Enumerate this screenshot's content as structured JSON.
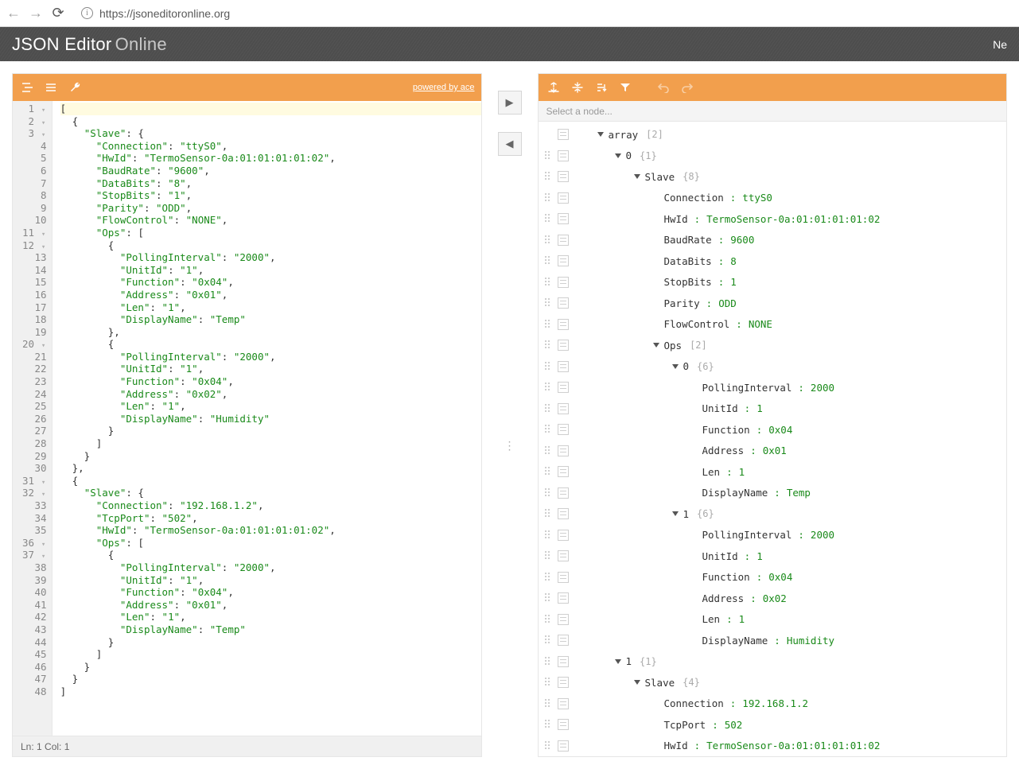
{
  "browser": {
    "url": "https://jsoneditoronline.org"
  },
  "header": {
    "title_strong": "JSON Editor",
    "title_light": "Online",
    "menu_right": "Ne"
  },
  "left": {
    "powered": "powered by ace",
    "status": "Ln: 1   Col: 1",
    "lines": [
      {
        "n": "1",
        "f": true,
        "hl": true,
        "t": "["
      },
      {
        "n": "2",
        "f": true,
        "t": "  {"
      },
      {
        "n": "3",
        "f": true,
        "t": "    \"Slave\": {",
        "seg": [
          [
            "k",
            "    "
          ],
          [
            "s",
            "\"Slave\""
          ],
          [
            "k",
            ": {"
          ]
        ]
      },
      {
        "n": "4",
        "t": "      \"Connection\": \"ttyS0\",",
        "seg": [
          [
            "k",
            "      "
          ],
          [
            "s",
            "\"Connection\""
          ],
          [
            "k",
            ": "
          ],
          [
            "s",
            "\"ttyS0\""
          ],
          [
            "k",
            ","
          ]
        ]
      },
      {
        "n": "5",
        "t": "",
        "seg": [
          [
            "k",
            "      "
          ],
          [
            "s",
            "\"HwId\""
          ],
          [
            "k",
            ": "
          ],
          [
            "s",
            "\"TermoSensor-0a:01:01:01:01:02\""
          ],
          [
            "k",
            ","
          ]
        ]
      },
      {
        "n": "6",
        "t": "",
        "seg": [
          [
            "k",
            "      "
          ],
          [
            "s",
            "\"BaudRate\""
          ],
          [
            "k",
            ": "
          ],
          [
            "s",
            "\"9600\""
          ],
          [
            "k",
            ","
          ]
        ]
      },
      {
        "n": "7",
        "t": "",
        "seg": [
          [
            "k",
            "      "
          ],
          [
            "s",
            "\"DataBits\""
          ],
          [
            "k",
            ": "
          ],
          [
            "s",
            "\"8\""
          ],
          [
            "k",
            ","
          ]
        ]
      },
      {
        "n": "8",
        "t": "",
        "seg": [
          [
            "k",
            "      "
          ],
          [
            "s",
            "\"StopBits\""
          ],
          [
            "k",
            ": "
          ],
          [
            "s",
            "\"1\""
          ],
          [
            "k",
            ","
          ]
        ]
      },
      {
        "n": "9",
        "t": "",
        "seg": [
          [
            "k",
            "      "
          ],
          [
            "s",
            "\"Parity\""
          ],
          [
            "k",
            ": "
          ],
          [
            "s",
            "\"ODD\""
          ],
          [
            "k",
            ","
          ]
        ]
      },
      {
        "n": "10",
        "t": "",
        "seg": [
          [
            "k",
            "      "
          ],
          [
            "s",
            "\"FlowControl\""
          ],
          [
            "k",
            ": "
          ],
          [
            "s",
            "\"NONE\""
          ],
          [
            "k",
            ","
          ]
        ]
      },
      {
        "n": "11",
        "f": true,
        "t": "",
        "seg": [
          [
            "k",
            "      "
          ],
          [
            "s",
            "\"Ops\""
          ],
          [
            "k",
            ": ["
          ]
        ]
      },
      {
        "n": "12",
        "f": true,
        "t": "        {"
      },
      {
        "n": "13",
        "t": "",
        "seg": [
          [
            "k",
            "          "
          ],
          [
            "s",
            "\"PollingInterval\""
          ],
          [
            "k",
            ": "
          ],
          [
            "s",
            "\"2000\""
          ],
          [
            "k",
            ","
          ]
        ]
      },
      {
        "n": "14",
        "t": "",
        "seg": [
          [
            "k",
            "          "
          ],
          [
            "s",
            "\"UnitId\""
          ],
          [
            "k",
            ": "
          ],
          [
            "s",
            "\"1\""
          ],
          [
            "k",
            ","
          ]
        ]
      },
      {
        "n": "15",
        "t": "",
        "seg": [
          [
            "k",
            "          "
          ],
          [
            "s",
            "\"Function\""
          ],
          [
            "k",
            ": "
          ],
          [
            "s",
            "\"0x04\""
          ],
          [
            "k",
            ","
          ]
        ]
      },
      {
        "n": "16",
        "t": "",
        "seg": [
          [
            "k",
            "          "
          ],
          [
            "s",
            "\"Address\""
          ],
          [
            "k",
            ": "
          ],
          [
            "s",
            "\"0x01\""
          ],
          [
            "k",
            ","
          ]
        ]
      },
      {
        "n": "17",
        "t": "",
        "seg": [
          [
            "k",
            "          "
          ],
          [
            "s",
            "\"Len\""
          ],
          [
            "k",
            ": "
          ],
          [
            "s",
            "\"1\""
          ],
          [
            "k",
            ","
          ]
        ]
      },
      {
        "n": "18",
        "t": "",
        "seg": [
          [
            "k",
            "          "
          ],
          [
            "s",
            "\"DisplayName\""
          ],
          [
            "k",
            ": "
          ],
          [
            "s",
            "\"Temp\""
          ]
        ]
      },
      {
        "n": "19",
        "t": "        },"
      },
      {
        "n": "20",
        "f": true,
        "t": "        {"
      },
      {
        "n": "21",
        "t": "",
        "seg": [
          [
            "k",
            "          "
          ],
          [
            "s",
            "\"PollingInterval\""
          ],
          [
            "k",
            ": "
          ],
          [
            "s",
            "\"2000\""
          ],
          [
            "k",
            ","
          ]
        ]
      },
      {
        "n": "22",
        "t": "",
        "seg": [
          [
            "k",
            "          "
          ],
          [
            "s",
            "\"UnitId\""
          ],
          [
            "k",
            ": "
          ],
          [
            "s",
            "\"1\""
          ],
          [
            "k",
            ","
          ]
        ]
      },
      {
        "n": "23",
        "t": "",
        "seg": [
          [
            "k",
            "          "
          ],
          [
            "s",
            "\"Function\""
          ],
          [
            "k",
            ": "
          ],
          [
            "s",
            "\"0x04\""
          ],
          [
            "k",
            ","
          ]
        ]
      },
      {
        "n": "24",
        "t": "",
        "seg": [
          [
            "k",
            "          "
          ],
          [
            "s",
            "\"Address\""
          ],
          [
            "k",
            ": "
          ],
          [
            "s",
            "\"0x02\""
          ],
          [
            "k",
            ","
          ]
        ]
      },
      {
        "n": "25",
        "t": "",
        "seg": [
          [
            "k",
            "          "
          ],
          [
            "s",
            "\"Len\""
          ],
          [
            "k",
            ": "
          ],
          [
            "s",
            "\"1\""
          ],
          [
            "k",
            ","
          ]
        ]
      },
      {
        "n": "26",
        "t": "",
        "seg": [
          [
            "k",
            "          "
          ],
          [
            "s",
            "\"DisplayName\""
          ],
          [
            "k",
            ": "
          ],
          [
            "s",
            "\"Humidity\""
          ]
        ]
      },
      {
        "n": "27",
        "t": "        }"
      },
      {
        "n": "28",
        "t": "      ]"
      },
      {
        "n": "29",
        "t": "    }"
      },
      {
        "n": "30",
        "t": "  },"
      },
      {
        "n": "31",
        "f": true,
        "t": "  {"
      },
      {
        "n": "32",
        "f": true,
        "t": "",
        "seg": [
          [
            "k",
            "    "
          ],
          [
            "s",
            "\"Slave\""
          ],
          [
            "k",
            ": {"
          ]
        ]
      },
      {
        "n": "33",
        "t": "",
        "seg": [
          [
            "k",
            "      "
          ],
          [
            "s",
            "\"Connection\""
          ],
          [
            "k",
            ": "
          ],
          [
            "s",
            "\"192.168.1.2\""
          ],
          [
            "k",
            ","
          ]
        ]
      },
      {
        "n": "34",
        "t": "",
        "seg": [
          [
            "k",
            "      "
          ],
          [
            "s",
            "\"TcpPort\""
          ],
          [
            "k",
            ": "
          ],
          [
            "s",
            "\"502\""
          ],
          [
            "k",
            ","
          ]
        ]
      },
      {
        "n": "35",
        "t": "",
        "seg": [
          [
            "k",
            "      "
          ],
          [
            "s",
            "\"HwId\""
          ],
          [
            "k",
            ": "
          ],
          [
            "s",
            "\"TermoSensor-0a:01:01:01:01:02\""
          ],
          [
            "k",
            ","
          ]
        ]
      },
      {
        "n": "36",
        "f": true,
        "t": "",
        "seg": [
          [
            "k",
            "      "
          ],
          [
            "s",
            "\"Ops\""
          ],
          [
            "k",
            ": ["
          ]
        ]
      },
      {
        "n": "37",
        "f": true,
        "t": "        {"
      },
      {
        "n": "38",
        "t": "",
        "seg": [
          [
            "k",
            "          "
          ],
          [
            "s",
            "\"PollingInterval\""
          ],
          [
            "k",
            ": "
          ],
          [
            "s",
            "\"2000\""
          ],
          [
            "k",
            ","
          ]
        ]
      },
      {
        "n": "39",
        "t": "",
        "seg": [
          [
            "k",
            "          "
          ],
          [
            "s",
            "\"UnitId\""
          ],
          [
            "k",
            ": "
          ],
          [
            "s",
            "\"1\""
          ],
          [
            "k",
            ","
          ]
        ]
      },
      {
        "n": "40",
        "t": "",
        "seg": [
          [
            "k",
            "          "
          ],
          [
            "s",
            "\"Function\""
          ],
          [
            "k",
            ": "
          ],
          [
            "s",
            "\"0x04\""
          ],
          [
            "k",
            ","
          ]
        ]
      },
      {
        "n": "41",
        "t": "",
        "seg": [
          [
            "k",
            "          "
          ],
          [
            "s",
            "\"Address\""
          ],
          [
            "k",
            ": "
          ],
          [
            "s",
            "\"0x01\""
          ],
          [
            "k",
            ","
          ]
        ]
      },
      {
        "n": "42",
        "t": "",
        "seg": [
          [
            "k",
            "          "
          ],
          [
            "s",
            "\"Len\""
          ],
          [
            "k",
            ": "
          ],
          [
            "s",
            "\"1\""
          ],
          [
            "k",
            ","
          ]
        ]
      },
      {
        "n": "43",
        "t": "",
        "seg": [
          [
            "k",
            "          "
          ],
          [
            "s",
            "\"DisplayName\""
          ],
          [
            "k",
            ": "
          ],
          [
            "s",
            "\"Temp\""
          ]
        ]
      },
      {
        "n": "44",
        "t": "        }"
      },
      {
        "n": "45",
        "t": "      ]"
      },
      {
        "n": "46",
        "t": "    }"
      },
      {
        "n": "47",
        "t": "  }"
      },
      {
        "n": "48",
        "t": "]"
      }
    ]
  },
  "right": {
    "placeholder": "Select a node...",
    "rows": [
      {
        "ind": 0,
        "caret": true,
        "key": "array",
        "count": "[2]",
        "top": true
      },
      {
        "ind": 1,
        "caret": true,
        "key": "0",
        "count": "{1}"
      },
      {
        "ind": 2,
        "caret": true,
        "key": "Slave",
        "count": "{8}"
      },
      {
        "ind": 3,
        "key": "Connection",
        "val": "ttyS0"
      },
      {
        "ind": 3,
        "key": "HwId",
        "val": "TermoSensor-0a:01:01:01:01:02"
      },
      {
        "ind": 3,
        "key": "BaudRate",
        "val": "9600"
      },
      {
        "ind": 3,
        "key": "DataBits",
        "val": "8"
      },
      {
        "ind": 3,
        "key": "StopBits",
        "val": "1"
      },
      {
        "ind": 3,
        "key": "Parity",
        "val": "ODD"
      },
      {
        "ind": 3,
        "key": "FlowControl",
        "val": "NONE"
      },
      {
        "ind": 3,
        "caret": true,
        "key": "Ops",
        "count": "[2]"
      },
      {
        "ind": 4,
        "caret": true,
        "key": "0",
        "count": "{6}"
      },
      {
        "ind": 5,
        "key": "PollingInterval",
        "val": "2000"
      },
      {
        "ind": 5,
        "key": "UnitId",
        "val": "1"
      },
      {
        "ind": 5,
        "key": "Function",
        "val": "0x04"
      },
      {
        "ind": 5,
        "key": "Address",
        "val": "0x01"
      },
      {
        "ind": 5,
        "key": "Len",
        "val": "1"
      },
      {
        "ind": 5,
        "key": "DisplayName",
        "val": "Temp"
      },
      {
        "ind": 4,
        "caret": true,
        "key": "1",
        "count": "{6}"
      },
      {
        "ind": 5,
        "key": "PollingInterval",
        "val": "2000"
      },
      {
        "ind": 5,
        "key": "UnitId",
        "val": "1"
      },
      {
        "ind": 5,
        "key": "Function",
        "val": "0x04"
      },
      {
        "ind": 5,
        "key": "Address",
        "val": "0x02"
      },
      {
        "ind": 5,
        "key": "Len",
        "val": "1"
      },
      {
        "ind": 5,
        "key": "DisplayName",
        "val": "Humidity"
      },
      {
        "ind": 1,
        "caret": true,
        "key": "1",
        "count": "{1}"
      },
      {
        "ind": 2,
        "caret": true,
        "key": "Slave",
        "count": "{4}"
      },
      {
        "ind": 3,
        "key": "Connection",
        "val": "192.168.1.2"
      },
      {
        "ind": 3,
        "key": "TcpPort",
        "val": "502"
      },
      {
        "ind": 3,
        "key": "HwId",
        "val": "TermoSensor-0a:01:01:01:01:02"
      }
    ]
  }
}
